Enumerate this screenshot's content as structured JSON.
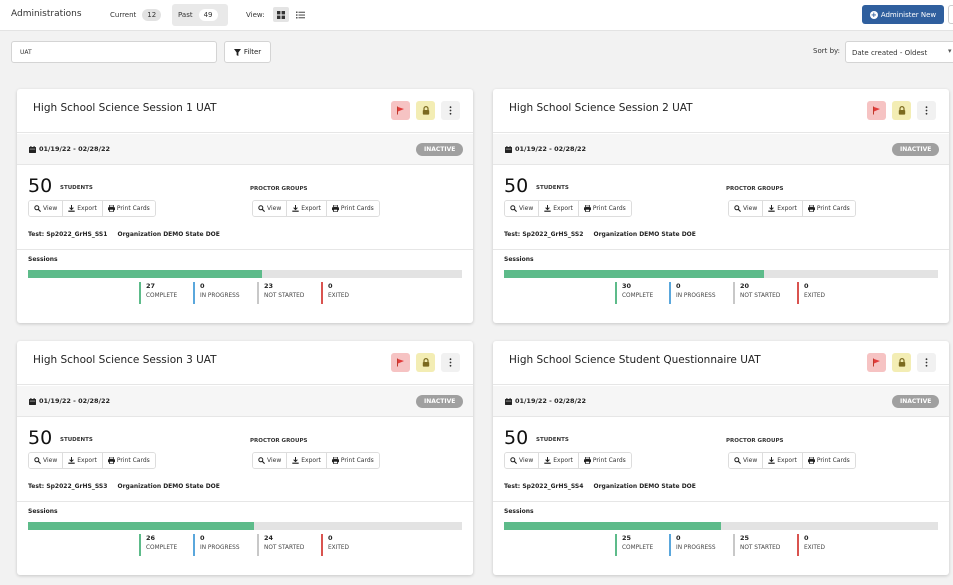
{
  "header": {
    "title": "Administrations",
    "current_label": "Current",
    "current_count": "12",
    "past_label": "Past",
    "past_count": "49",
    "view_label": "View:",
    "administer_label": "Administer New"
  },
  "toolbar": {
    "search_value": "UAT",
    "filter_label": "Filter",
    "sort_label": "Sort by:",
    "sort_value": "Date created - Oldest"
  },
  "card_labels": {
    "students_label": "STUDENTS",
    "proctor_label": "PROCTOR GROUPS",
    "view": "View",
    "export": "Export",
    "print": "Print Cards",
    "test_prefix": "Test:",
    "org_prefix": "Organization",
    "sessions": "Sessions",
    "complete": "COMPLETE",
    "in_progress": "IN PROGRESS",
    "not_started": "NOT STARTED",
    "exited": "EXITED"
  },
  "colors": {
    "accent": "#2f5f9e",
    "complete": "#5dbb8a",
    "in_progress": "#5aa7dc",
    "not_started": "#c8c8c8",
    "exited": "#d9534f",
    "inactive_badge": "#a0a0a0"
  },
  "cards": [
    {
      "title": "High School Science Session 1 UAT",
      "dates": "01/19/22 - 02/28/22",
      "status": "INACTIVE",
      "students": "50",
      "test": "Sp2022_GrHS_SS1",
      "organization": "DEMO State DOE",
      "complete": "27",
      "in_progress": "0",
      "not_started": "23",
      "exited": "0",
      "progress_fraction": 0.54
    },
    {
      "title": "High School Science Session 2 UAT",
      "dates": "01/19/22 - 02/28/22",
      "status": "INACTIVE",
      "students": "50",
      "test": "Sp2022_GrHS_SS2",
      "organization": "DEMO State DOE",
      "complete": "30",
      "in_progress": "0",
      "not_started": "20",
      "exited": "0",
      "progress_fraction": 0.6
    },
    {
      "title": "High School Science Session 3 UAT",
      "dates": "01/19/22 - 02/28/22",
      "status": "INACTIVE",
      "students": "50",
      "test": "Sp2022_GrHS_SS3",
      "organization": "DEMO State DOE",
      "complete": "26",
      "in_progress": "0",
      "not_started": "24",
      "exited": "0",
      "progress_fraction": 0.52
    },
    {
      "title": "High School Science Student Questionnaire UAT",
      "dates": "01/19/22 - 02/28/22",
      "status": "INACTIVE",
      "students": "50",
      "test": "Sp2022_GrHS_SS4",
      "organization": "DEMO State DOE",
      "complete": "25",
      "in_progress": "0",
      "not_started": "25",
      "exited": "0",
      "progress_fraction": 0.5
    }
  ]
}
